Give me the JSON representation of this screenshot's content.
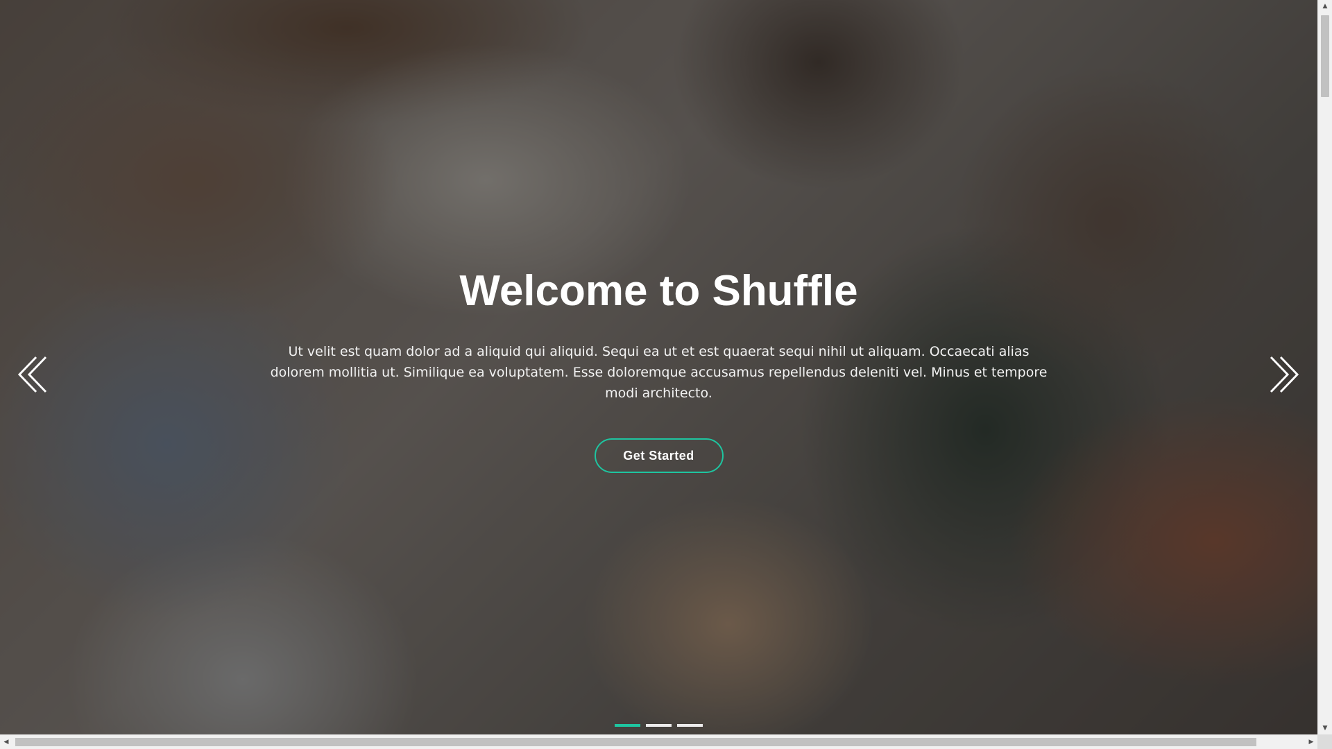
{
  "hero": {
    "title": "Welcome to Shuffle",
    "text": "Ut velit est quam dolor ad a aliquid qui aliquid. Sequi ea ut et est quaerat sequi nihil ut aliquam. Occaecati alias dolorem mollitia ut. Similique ea voluptatem. Esse doloremque accusamus repellendus deleniti vel. Minus et tempore modi architecto.",
    "cta_label": "Get Started",
    "background_description_icon": "team-hands-together-photo"
  },
  "carousel": {
    "prev_icon": "double-chevron-left-icon",
    "next_icon": "double-chevron-right-icon",
    "slide_count": 3,
    "active_slide": 1
  },
  "colors": {
    "accent": "#1ec5a0",
    "text": "#ffffff"
  }
}
